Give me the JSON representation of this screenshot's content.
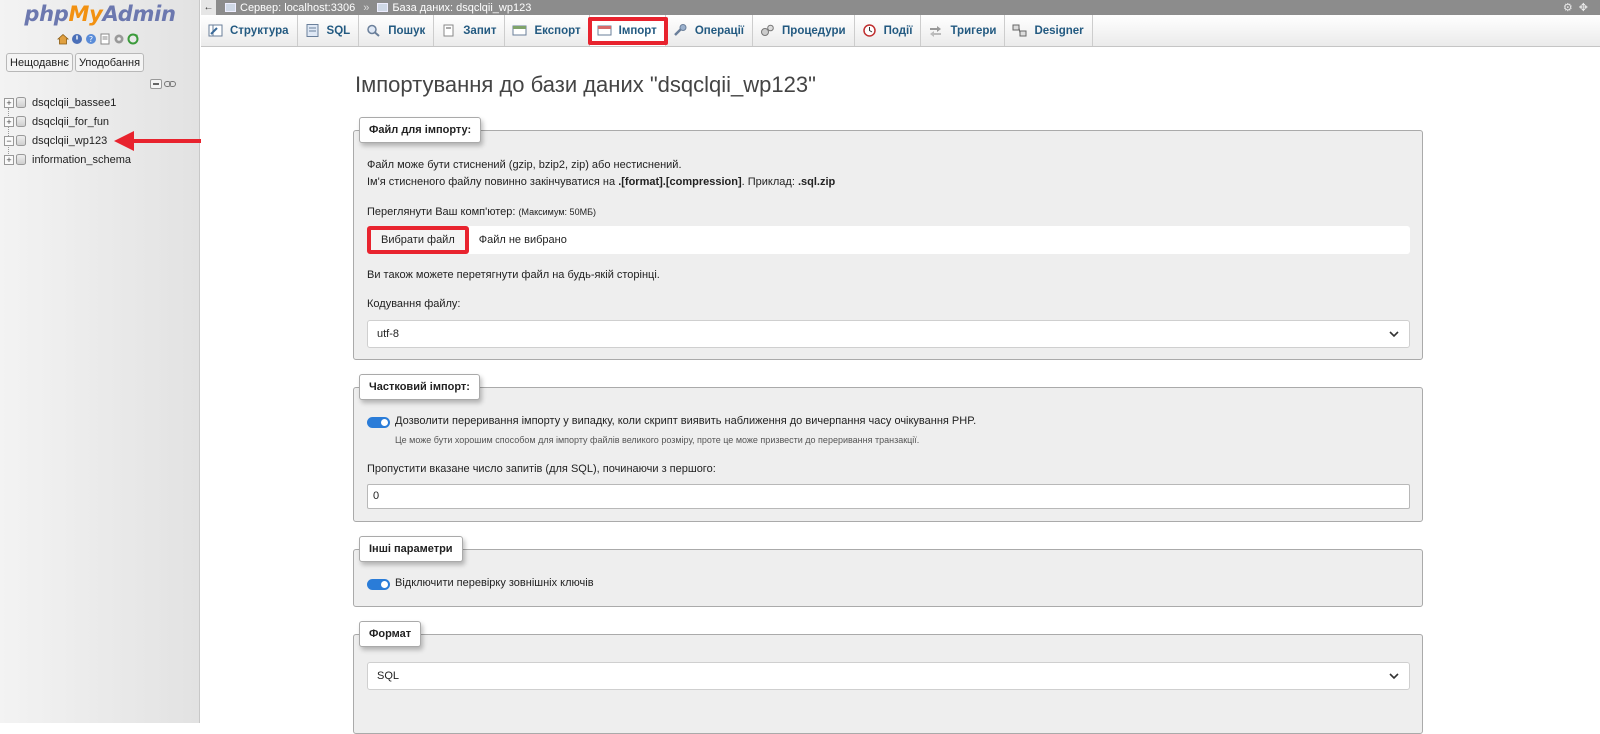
{
  "nav": {
    "logo_php": "php",
    "logo_my": "My",
    "logo_admin": "Admin",
    "quick_icons": [
      "home-icon",
      "logout-icon",
      "docs-icon",
      "settings-icon",
      "reload-icon"
    ],
    "recent_label": "Нещодавнє",
    "favorites_label": "Уподобання",
    "databases": [
      {
        "name": "dsqclqii_bassee1",
        "expanded": false
      },
      {
        "name": "dsqclqii_for_fun",
        "expanded": false
      },
      {
        "name": "dsqclqii_wp123",
        "expanded": true
      },
      {
        "name": "information_schema",
        "expanded": false
      }
    ]
  },
  "topbar": {
    "server": "Сервер: localhost:3306",
    "database": "База даних: dsqclqii_wp123"
  },
  "tabs": [
    {
      "label": "Структура",
      "icon": "structure-icon",
      "active": false
    },
    {
      "label": "SQL",
      "icon": "sql-icon",
      "active": false
    },
    {
      "label": "Пошук",
      "icon": "search-icon",
      "active": false
    },
    {
      "label": "Запит",
      "icon": "query-icon",
      "active": false
    },
    {
      "label": "Експорт",
      "icon": "export-icon",
      "active": false
    },
    {
      "label": "Імпорт",
      "icon": "import-icon",
      "active": true
    },
    {
      "label": "Операції",
      "icon": "wrench-icon",
      "active": false
    },
    {
      "label": "Процедури",
      "icon": "routines-icon",
      "active": false
    },
    {
      "label": "Події",
      "icon": "clock-icon",
      "active": false
    },
    {
      "label": "Тригери",
      "icon": "triggers-icon",
      "active": false
    },
    {
      "label": "Designer",
      "icon": "designer-icon",
      "active": false
    }
  ],
  "main": {
    "title": "Імпортування до бази даних \"dsqclqii_wp123\"",
    "file_section": {
      "legend": "Файл для імпорту:",
      "line1": "Файл може бути стиснений (gzip, bzip2, zip) або нестиснений.",
      "line2_prefix": "Ім'я стисненого файлу повинно закінчуватися на ",
      "line2_format": ".[format].[compression]",
      "line2_mid": ". Приклад: ",
      "line2_example": ".sql.zip",
      "browse_label": "Переглянути Ваш комп'ютер:",
      "browse_max": "(Максимум: 50МБ)",
      "choose_button": "Вибрати файл",
      "no_file": "Файл не вибрано",
      "drag_hint": "Ви також можете перетягнути файл на будь-якій сторінці.",
      "encoding_label": "Кодування файлу:",
      "encoding_value": "utf-8"
    },
    "partial_section": {
      "legend": "Частковий імпорт:",
      "allow_interrupt": "Дозволити переривання імпорту у випадку, коли скрипт виявить наближення до вичерпання часу очікування PHP.",
      "allow_interrupt_note": "Це може бути хорошим способом для імпорту файлів великого розміру, проте це може призвести до переривання транзакції.",
      "allow_interrupt_enabled": true,
      "skip_label": "Пропустити вказане число запитів (для SQL), починаючи з першого:",
      "skip_value": "0"
    },
    "other_section": {
      "legend": "Інші параметри",
      "fk_checks": "Відключити перевірку зовнішніх ключів",
      "fk_checks_enabled": true
    },
    "format_section": {
      "legend": "Формат",
      "format_value": "SQL"
    }
  },
  "colors": {
    "accent_blue": "#235a81",
    "highlight_red": "#e8232e",
    "toggle_on": "#2a7cd8"
  }
}
